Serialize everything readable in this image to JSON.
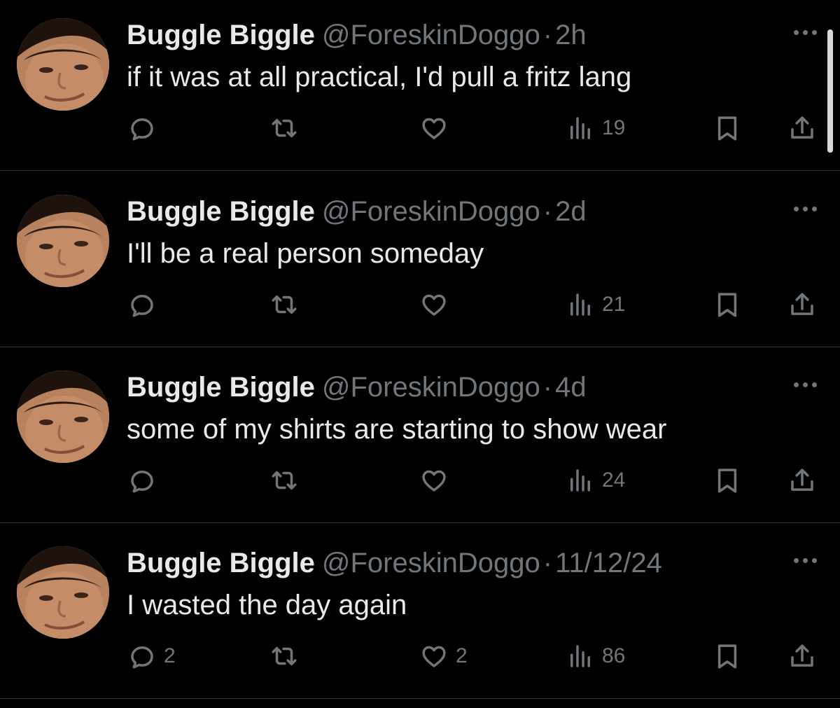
{
  "colors": {
    "background": "#000000",
    "primary_text": "#e7e9ea",
    "secondary_text": "#71767b",
    "divider": "#2f3336"
  },
  "icons": {
    "more": "more-horizontal-icon",
    "reply": "reply-icon",
    "retweet": "retweet-icon",
    "like": "heart-icon",
    "views": "views-icon",
    "bookmark": "bookmark-icon",
    "share": "share-icon"
  },
  "tweets": [
    {
      "display_name": "Buggle Biggle",
      "handle": "@ForeskinDoggo",
      "separator": "·",
      "time": "2h",
      "text": "if it was at all practical, I'd pull a fritz lang",
      "replies": "",
      "retweets": "",
      "likes": "",
      "views": "19"
    },
    {
      "display_name": "Buggle Biggle",
      "handle": "@ForeskinDoggo",
      "separator": "·",
      "time": "2d",
      "text": "I'll be a real person someday",
      "replies": "",
      "retweets": "",
      "likes": "",
      "views": "21"
    },
    {
      "display_name": "Buggle Biggle",
      "handle": "@ForeskinDoggo",
      "separator": "·",
      "time": "4d",
      "text": "some of my shirts are starting to show wear",
      "replies": "",
      "retweets": "",
      "likes": "",
      "views": "24"
    },
    {
      "display_name": "Buggle Biggle",
      "handle": "@ForeskinDoggo",
      "separator": "·",
      "time": "11/12/24",
      "text": "I wasted the day again",
      "replies": "2",
      "retweets": "",
      "likes": "2",
      "views": "86"
    }
  ]
}
